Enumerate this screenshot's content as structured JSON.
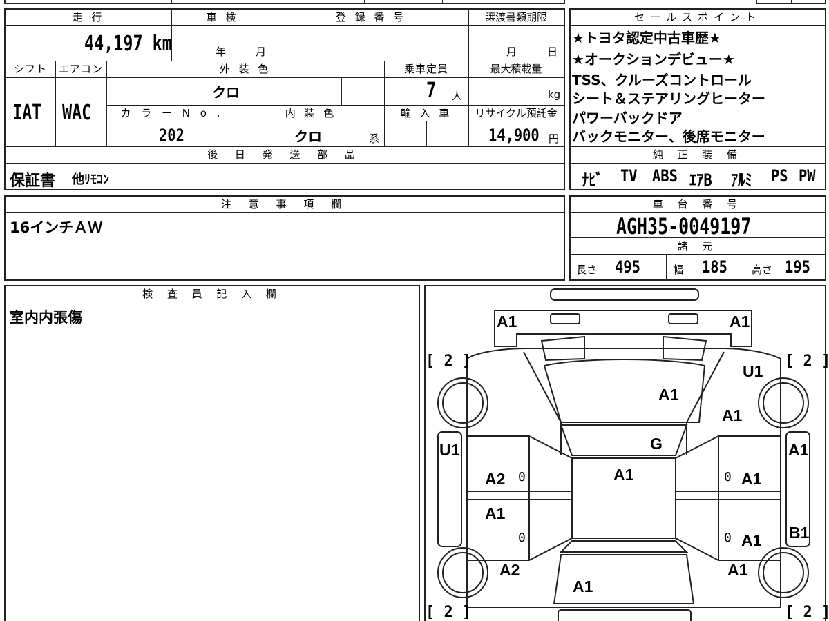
{
  "top": {
    "mileage_label": "走 行",
    "mileage_value": "44,197 km",
    "shaken_label": "車 検",
    "shaken_year": "年",
    "shaken_month": "月",
    "registration_label": "登 録 番 号",
    "transfer_label": "譲渡書類期限",
    "transfer_month": "月",
    "transfer_day": "日",
    "shift_label": "シフト",
    "shift_value": "IAT",
    "aircon_label": "エアコン",
    "aircon_value": "WAC",
    "exterior_label": "外 装 色",
    "exterior_value": "クロ",
    "capacity_label": "乗車定員",
    "capacity_value": "7",
    "capacity_unit": "人",
    "maxload_label": "最大積載量",
    "maxload_unit": "kg",
    "color_no_label": "カ ラ ー N o .",
    "color_no_value": "202",
    "interior_label": "内 装 色",
    "interior_value": "クロ",
    "interior_unit": "系",
    "import_label": "輸 入 車",
    "recycle_label": "リサイクル預託金",
    "recycle_value": "14,900",
    "recycle_unit": "円",
    "later_parts_label": "後 日 発 送 部 品",
    "later_parts_value_1": "保証書",
    "later_parts_value_2": "他ﾘﾓｺﾝ"
  },
  "sales": {
    "header": "セールスポイント",
    "points": [
      "★トヨタ認定中古車歴★",
      "★オークションデビュー★",
      "TSS、クルーズコントロール",
      "シート＆ステアリングヒーター",
      "パワーバックドア",
      "バックモニター、後席モニター"
    ],
    "equipment_label": "純 正 装 備",
    "equipment": [
      "ﾅﾋﾞ",
      "TV",
      "ABS",
      "ｴｱB",
      "ｱﾙﾐ",
      "PS",
      "PW"
    ]
  },
  "notes": {
    "label": "注 意 事 項 欄",
    "text": "16インチＡＷ"
  },
  "chassis": {
    "label": "車 台 番 号",
    "value": "AGH35-0049197",
    "specs_label": "諸 元",
    "length_label": "長さ",
    "length_value": "495",
    "width_label": "幅",
    "width_value": "185",
    "height_label": "高さ",
    "height_value": "195"
  },
  "inspector": {
    "label": "検 査 員 記 入 欄",
    "text": "室内内張傷"
  },
  "diagram": {
    "marks": {
      "front_left": "A1",
      "front_right": "A1",
      "hood": "A1",
      "fender_fr": "A1",
      "upper_right": "U1",
      "windshield": "G",
      "roof": "A1",
      "left_rocker": "U1",
      "right_a1": "A1",
      "right_b1": "B1",
      "door_fl": "A2",
      "door_rl": "A1",
      "door_fr": "A1",
      "door_rr": "A1",
      "rear_left": "A2",
      "rear_right": "A1",
      "tailgate": "A1"
    },
    "tire_marks": [
      "[ 2 ]",
      "[ 2 ]",
      "[ 2 ]",
      "[ 2 ]"
    ],
    "zero": "0"
  }
}
